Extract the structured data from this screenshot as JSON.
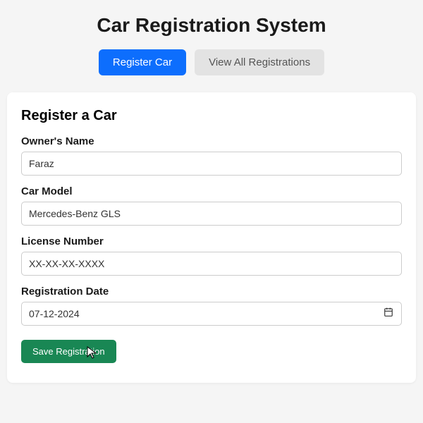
{
  "title": "Car Registration System",
  "tabs": {
    "register": "Register Car",
    "viewAll": "View All Registrations"
  },
  "form": {
    "heading": "Register a Car",
    "ownerName": {
      "label": "Owner's Name",
      "value": "Faraz"
    },
    "carModel": {
      "label": "Car Model",
      "value": "Mercedes-Benz GLS"
    },
    "licenseNumber": {
      "label": "License Number",
      "value": "XX-XX-XX-XXXX"
    },
    "registrationDate": {
      "label": "Registration Date",
      "value": "07-12-2024"
    },
    "saveButton": "Save Registration"
  },
  "colors": {
    "primary": "#0d6efd",
    "success": "#198754",
    "inactive": "#e3e3e3"
  }
}
